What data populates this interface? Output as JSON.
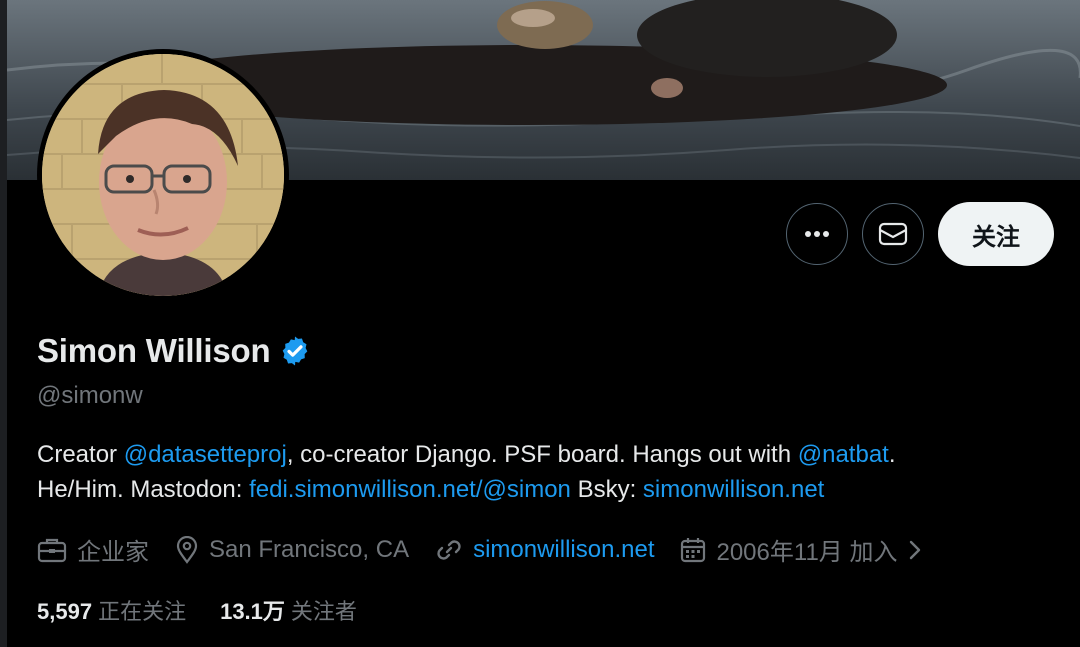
{
  "profile": {
    "name": "Simon Willison",
    "handle": "@simonw",
    "verified_color": "#1d9bf0"
  },
  "actions": {
    "more_icon": "more-icon",
    "message_icon": "envelope-icon",
    "follow_label": "关注"
  },
  "bio": {
    "t1": "Creator ",
    "l1": "@datasetteproj",
    "t2": ", co-creator Django. PSF board. Hangs out with ",
    "l2": "@natbat",
    "t3": ".",
    "t4": "He/Him. Mastodon: ",
    "l3": "fedi.simonwillison.net/@simon",
    "t5": " Bsky: ",
    "l4": "simonwillison.net"
  },
  "meta": {
    "profession": "企业家",
    "location": "San Francisco, CA",
    "website": "simonwillison.net",
    "joined": "2006年11月 加入"
  },
  "stats": {
    "following_count": "5,597",
    "following_label": "正在关注",
    "followers_count": "13.1万",
    "followers_label": "关注者"
  },
  "colors": {
    "link": "#1d9bf0",
    "muted": "#71767b",
    "text": "#e7e9ea"
  }
}
